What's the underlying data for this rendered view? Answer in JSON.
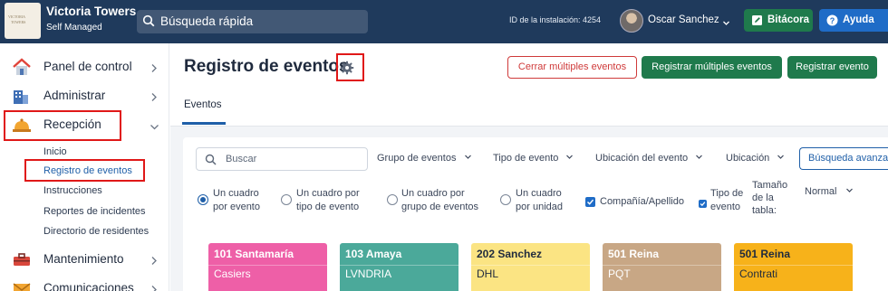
{
  "topbar": {
    "logo_text": [
      "VICTORIA",
      "TOWERS"
    ],
    "app_title": "Victoria Towers",
    "app_subtitle": "Self Managed",
    "search_placeholder": "Búsqueda rápida",
    "install_id": "ID de la instalación: 4254",
    "user_name": "Oscar Sanchez",
    "bitacora_label": "Bitácora",
    "ayuda_label": "Ayuda"
  },
  "sidebar": {
    "items": [
      {
        "label": "Panel de control",
        "icon": "home-icon"
      },
      {
        "label": "Administrar",
        "icon": "building-icon"
      },
      {
        "label": "Recepción",
        "icon": "reception-bell-icon"
      },
      {
        "label": "Mantenimiento",
        "icon": "toolbox-icon"
      },
      {
        "label": "Comunicaciones",
        "icon": "envelope-icon"
      }
    ],
    "recepcion_subitems": [
      "Inicio",
      "Registro de eventos",
      "Instrucciones",
      "Reportes de incidentes",
      "Directorio de residentes"
    ]
  },
  "main": {
    "page_title": "Registro de eventos",
    "buttons": {
      "close_multiple": "Cerrar múltiples eventos",
      "register_multiple": "Registrar múltiples eventos",
      "register_event": "Registrar evento"
    },
    "tab_events": "Eventos",
    "filters": {
      "search_placeholder": "Buscar",
      "event_group": "Grupo de eventos",
      "event_type": "Tipo de evento",
      "event_location": "Ubicación del evento",
      "location": "Ubicación",
      "advanced_search": "Búsqueda avanzada"
    },
    "view_options": {
      "one_per_event": [
        "Un cuadro",
        "por evento"
      ],
      "one_per_type": [
        "Un cuadro por",
        "tipo de evento"
      ],
      "one_per_group": [
        "Un cuadro por",
        "grupo de eventos"
      ],
      "one_per_unit": [
        "Un cuadro",
        "por unidad"
      ],
      "company_surname": "Compañía/Apellido",
      "event_type_check": [
        "Tipo de",
        "evento"
      ],
      "table_size_label": [
        "Tamaño",
        "de la",
        "tabla:"
      ],
      "table_size_value": "Normal"
    },
    "cards": [
      {
        "title": "101 Santamaría",
        "sub": "Casiers",
        "color": "#ee5fa7"
      },
      {
        "title": "103 Amaya",
        "sub": "LVNDRIA",
        "color": "#4ba99a"
      },
      {
        "title": "202 Sanchez",
        "sub": "DHL",
        "color": "#fbe483"
      },
      {
        "title": "501 Reina",
        "sub": "PQT",
        "color": "#c8a785"
      },
      {
        "title": "501 Reina",
        "sub": "Contrati",
        "color": "#f7b21a"
      }
    ]
  },
  "colors": {
    "topbar": "#1f3a5c",
    "green": "#1f7a4c",
    "blue": "#1f6cc7",
    "highlight_red": "#e01818"
  }
}
